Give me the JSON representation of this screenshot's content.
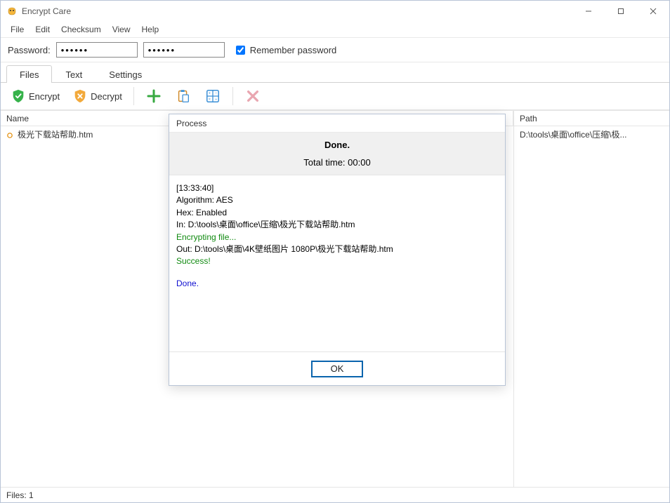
{
  "app": {
    "title": "Encrypt Care"
  },
  "menu": {
    "file": "File",
    "edit": "Edit",
    "checksum": "Checksum",
    "view": "View",
    "help": "Help"
  },
  "passwordbar": {
    "label": "Password:",
    "value1": "••••••",
    "value2": "••••••",
    "remember_label": "Remember password",
    "remember_checked": true
  },
  "tabs": {
    "files": "Files",
    "text": "Text",
    "settings": "Settings",
    "active": "files"
  },
  "toolbar": {
    "encrypt": "Encrypt",
    "decrypt": "Decrypt"
  },
  "columns": {
    "name": "Name",
    "path": "Path"
  },
  "rows": [
    {
      "name": "极光下载站帮助.htm",
      "path": "D:\\tools\\桌面\\office\\压缩\\极..."
    }
  ],
  "status": {
    "files": "Files: 1"
  },
  "dialog": {
    "title": "Process",
    "done": "Done.",
    "total_time": "Total time: 00:00",
    "log": {
      "ts": "[13:33:40]",
      "algo": "Algorithm: AES",
      "hex": "Hex: Enabled",
      "in": "In: D:\\tools\\桌面\\office\\压缩\\极光下载站帮助.htm",
      "encrypting": "Encrypting file...",
      "out": "Out: D:\\tools\\桌面\\4K壁纸图片 1080P\\极光下载站帮助.htm",
      "success": "Success!",
      "done": "Done."
    },
    "ok": "OK"
  }
}
